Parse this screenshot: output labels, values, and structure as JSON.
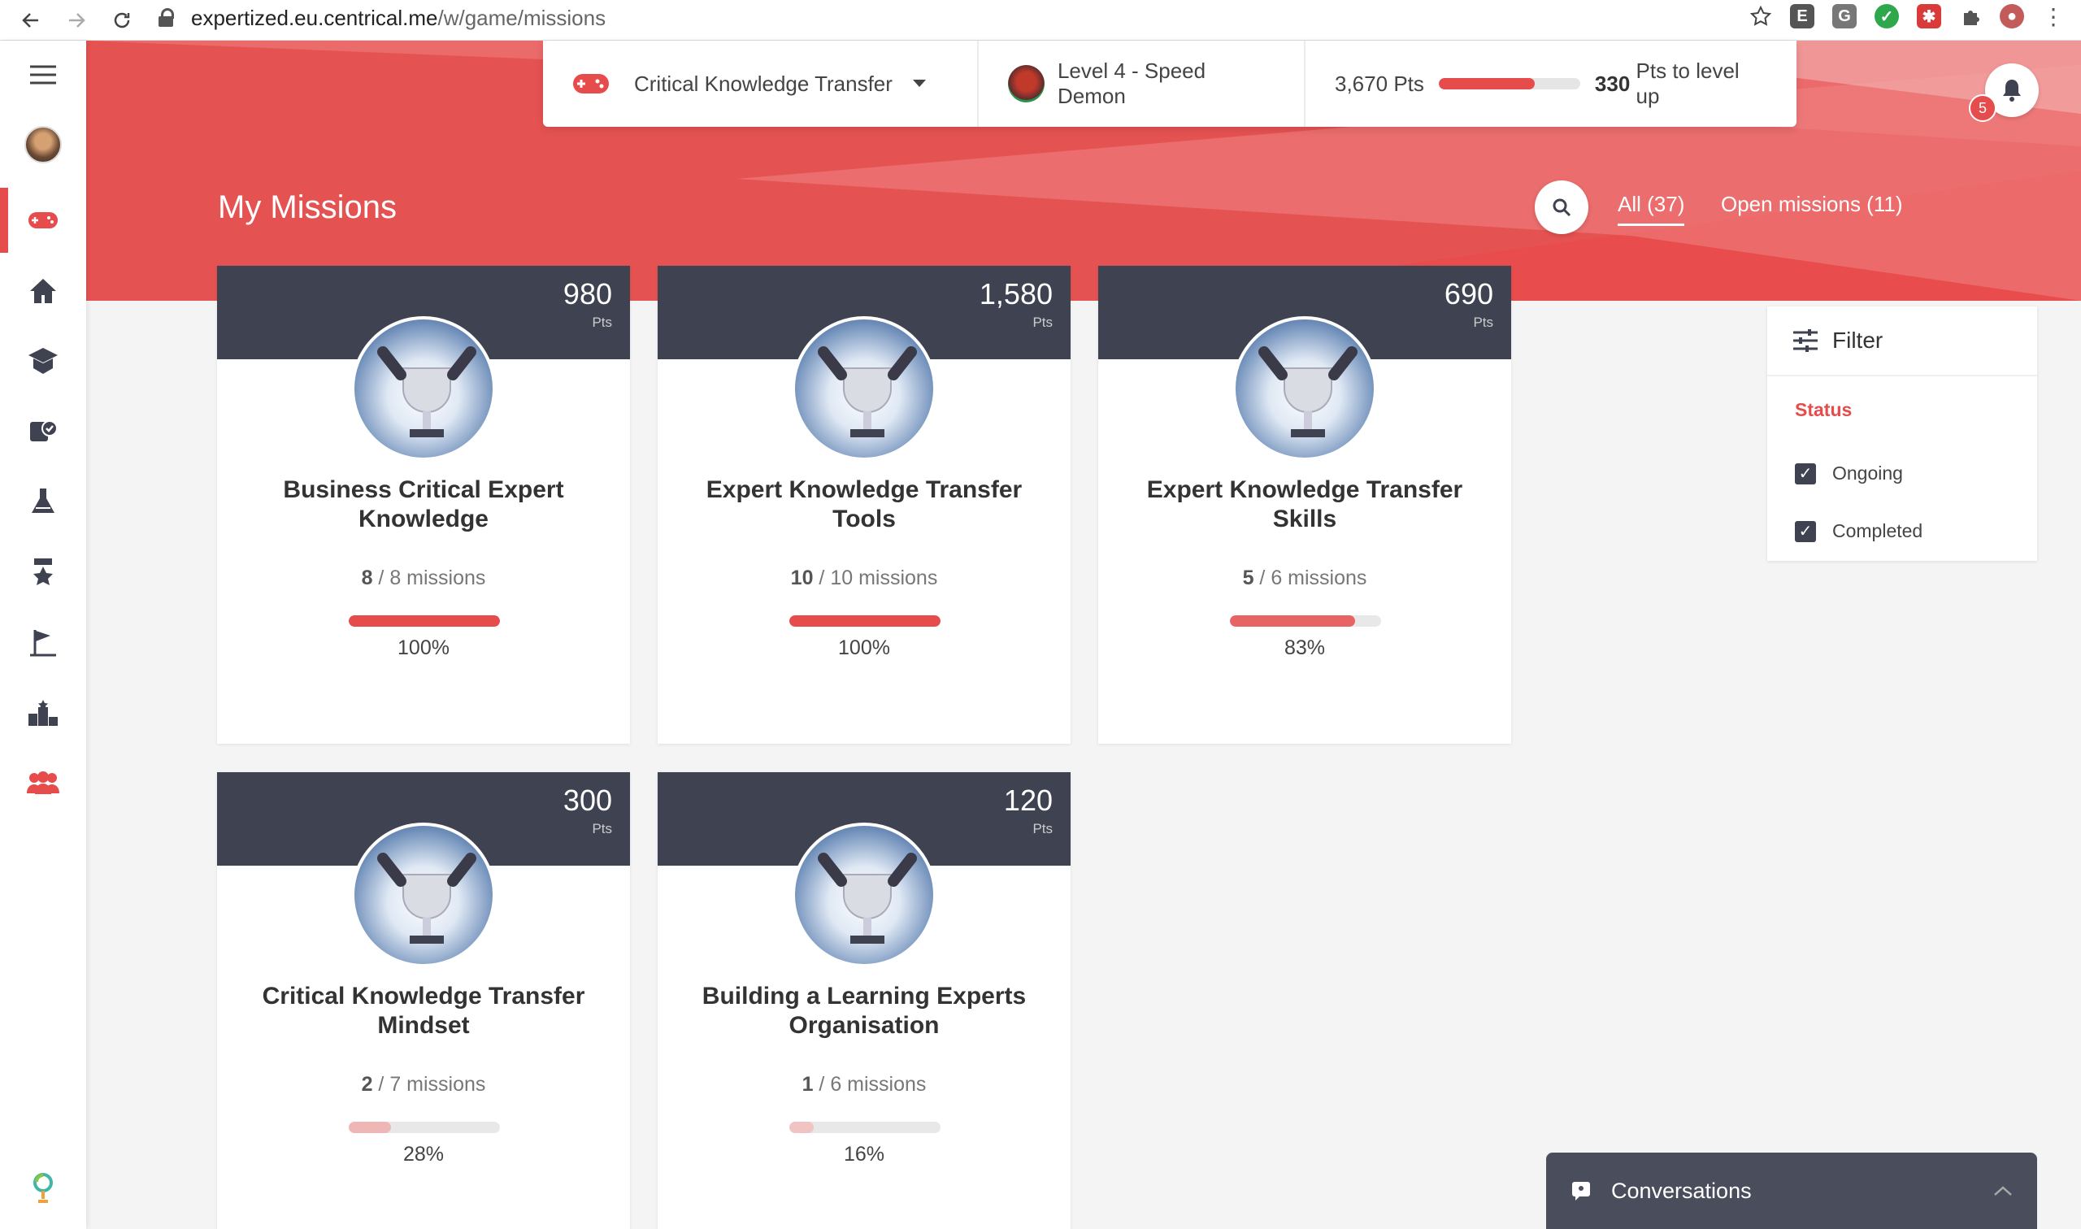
{
  "browser": {
    "url_host": "expertized.eu.centrical.me",
    "url_path": "/w/game/missions"
  },
  "topbar": {
    "game_name": "Critical Knowledge Transfer",
    "level": "Level 4 - Speed Demon",
    "points": "3,670",
    "points_unit": "Pts",
    "points_progress": 0.68,
    "to_level_up_value": "330",
    "to_level_up_text": "Pts to level up"
  },
  "notifications": {
    "count": "5"
  },
  "page": {
    "title": "My Missions"
  },
  "tabs": [
    {
      "label": "All (37)",
      "active": true
    },
    {
      "label": "Open missions (11)",
      "active": false
    }
  ],
  "missions": [
    {
      "points": "980",
      "unit": "Pts",
      "title": "Business Critical Expert Knowledge",
      "done": "8",
      "total_text": " / 8 missions",
      "progress": 1.0,
      "progress_label": "100%",
      "color": "#e74c4c"
    },
    {
      "points": "1,580",
      "unit": "Pts",
      "title": "Expert Knowledge Transfer Tools",
      "done": "10",
      "total_text": " / 10 missions",
      "progress": 1.0,
      "progress_label": "100%",
      "color": "#e74c4c"
    },
    {
      "points": "690",
      "unit": "Pts",
      "title": "Expert Knowledge Transfer Skills",
      "done": "5",
      "total_text": " / 6 missions",
      "progress": 0.83,
      "progress_label": "83%",
      "color": "#e86464"
    },
    {
      "points": "300",
      "unit": "Pts",
      "title": "Critical Knowledge Transfer Mindset",
      "done": "2",
      "total_text": " / 7 missions",
      "progress": 0.28,
      "progress_label": "28%",
      "color": "#efb6b6"
    },
    {
      "points": "120",
      "unit": "Pts",
      "title": "Building a Learning Experts Organisation",
      "done": "1",
      "total_text": " / 6 missions",
      "progress": 0.16,
      "progress_label": "16%",
      "color": "#f2c3c3"
    }
  ],
  "filter": {
    "title": "Filter",
    "status_label": "Status",
    "options": [
      {
        "label": "Ongoing",
        "checked": true
      },
      {
        "label": "Completed",
        "checked": true
      }
    ]
  },
  "conversations": {
    "label": "Conversations"
  },
  "sidebar": {
    "icons": [
      "menu-icon",
      "avatar",
      "game-controller-icon",
      "home-icon",
      "learning-icon",
      "tasks-icon",
      "challenge-icon",
      "achievements-icon",
      "goals-icon",
      "leaderboard-icon",
      "team-icon",
      "brand-logo-icon"
    ]
  },
  "colors": {
    "accent": "#e74c4c",
    "card_header": "#3f4351"
  }
}
